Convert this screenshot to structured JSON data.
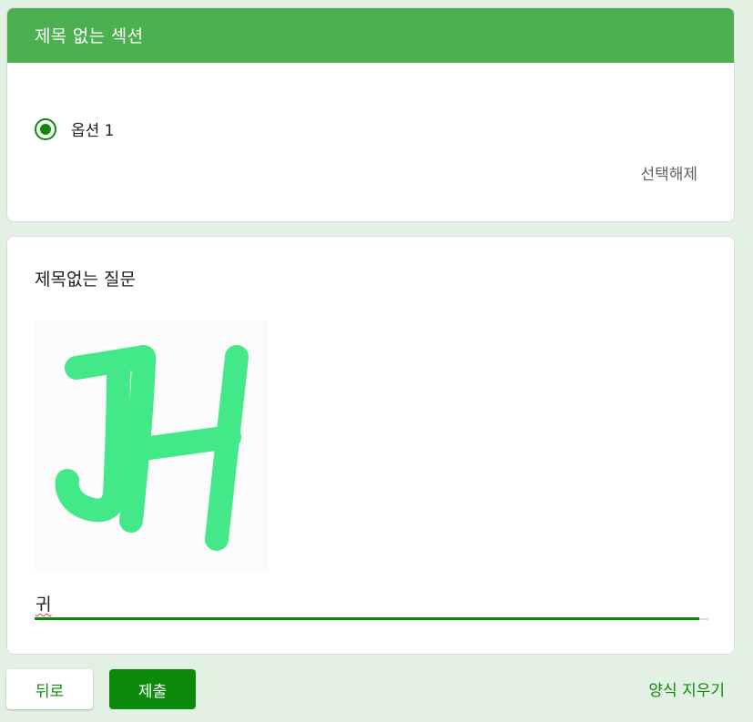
{
  "section": {
    "title": "제목 없는 섹션",
    "option_label": "옵션 1",
    "option_selected": true,
    "clear_selection": "선택해제"
  },
  "question": {
    "title": "제목없는 질문",
    "image_text": "JH",
    "answer_value": "귀"
  },
  "footer": {
    "back_label": "뒤로",
    "submit_label": "제출",
    "clear_form_label": "양식 지우기"
  },
  "colors": {
    "accent": "#0b8a0b",
    "header": "#4caf50",
    "background": "#e3f1e4",
    "image_stroke": "#43e889"
  }
}
